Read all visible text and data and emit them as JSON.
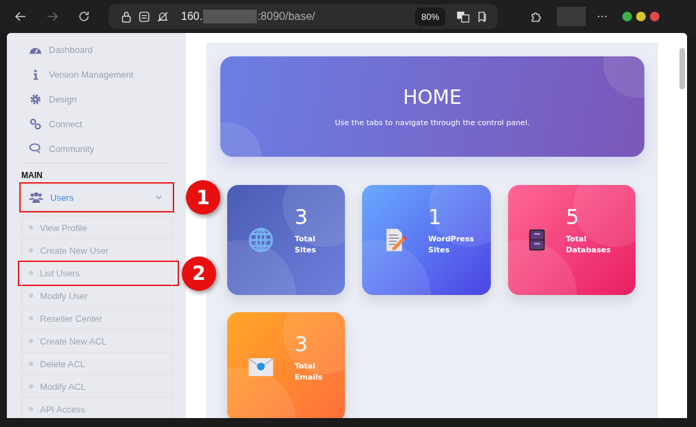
{
  "browser": {
    "url_prefix": "160.",
    "url_suffix": ":8090/base/",
    "zoom": "80%",
    "more": "···"
  },
  "sidebar": {
    "items": [
      {
        "label": "Dashboard",
        "kind": "dashboard"
      },
      {
        "label": "Version Management",
        "kind": "info"
      },
      {
        "label": "Design",
        "kind": "gear"
      },
      {
        "label": "Connect",
        "kind": "link"
      },
      {
        "label": "Community",
        "kind": "chat"
      }
    ],
    "section": "MAIN",
    "menu": {
      "label": "Users",
      "expanded": true,
      "highlighted": true,
      "callout": "1"
    },
    "submenu": [
      {
        "label": "View Profile",
        "highlighted": false
      },
      {
        "label": "Create New User",
        "highlighted": false
      },
      {
        "label": "List Users",
        "highlighted": true,
        "callout": "2"
      },
      {
        "label": "Modify User",
        "highlighted": false
      },
      {
        "label": "Reseller Center",
        "highlighted": false
      },
      {
        "label": "Create New ACL",
        "highlighted": false
      },
      {
        "label": "Delete ACL",
        "highlighted": false
      },
      {
        "label": "Modify ACL",
        "highlighted": false
      },
      {
        "label": "API Access",
        "highlighted": false
      }
    ]
  },
  "hero": {
    "title": "HOME",
    "subtitle": "Use the tabs to navigate through the control panel."
  },
  "stats": [
    {
      "value": "3",
      "label": "Total Sites",
      "kind": "sites"
    },
    {
      "value": "1",
      "label": "WordPress Sites",
      "kind": "wordpress"
    },
    {
      "value": "5",
      "label": "Total Databases",
      "kind": "databases"
    },
    {
      "value": "3",
      "label": "Total Emails",
      "kind": "emails"
    }
  ]
}
